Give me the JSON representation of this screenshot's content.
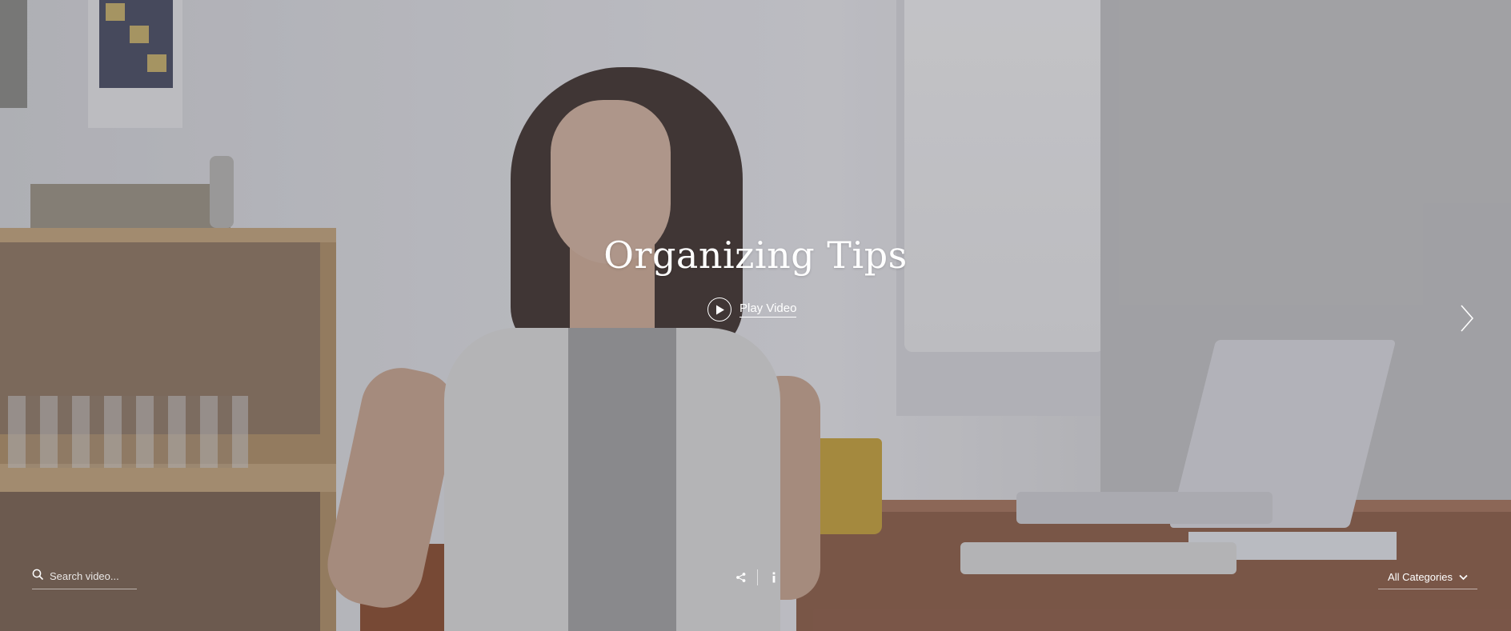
{
  "hero": {
    "title": "Organizing Tips",
    "play_label": "Play Video"
  },
  "search": {
    "placeholder": "Search video...",
    "value": ""
  },
  "category_filter": {
    "selected": "All Categories"
  },
  "icons": {
    "play": "play-icon",
    "next": "chevron-right-icon",
    "search": "search-icon",
    "share": "share-icon",
    "info": "info-icon",
    "dropdown": "chevron-down-icon"
  },
  "colors": {
    "text": "#ffffff",
    "overlay": "#48484e"
  }
}
